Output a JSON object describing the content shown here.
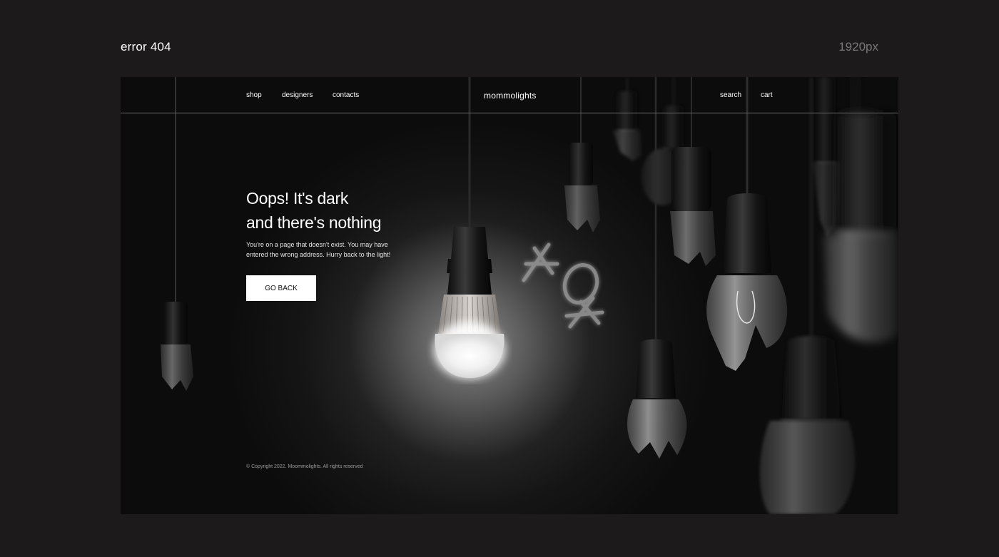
{
  "presentation": {
    "title": "error 404",
    "width_label": "1920px"
  },
  "header": {
    "nav_left": [
      "shop",
      "designers",
      "contacts"
    ],
    "brand": "mommolights",
    "nav_right": [
      "search",
      "cart"
    ]
  },
  "hero": {
    "headline_line1": "Oops! It's dark",
    "headline_line2": "and there's nothing",
    "description": "You're on a page that doesn't exist. You may have entered the wrong address. Hurry back to the light!",
    "button_label": "GO BACK",
    "glow_text": "404"
  },
  "footer": {
    "copyright": "© Copyright 2022. Moommolights. All rights reserved"
  },
  "colors": {
    "page_background": "#1c1a1b",
    "frame_background": "#0c0c0c",
    "text": "#ffffff",
    "muted": "#7a7879",
    "button_background": "#ffffff"
  },
  "icons": [
    "light-bulb-icon",
    "broken-bulb-icon"
  ]
}
